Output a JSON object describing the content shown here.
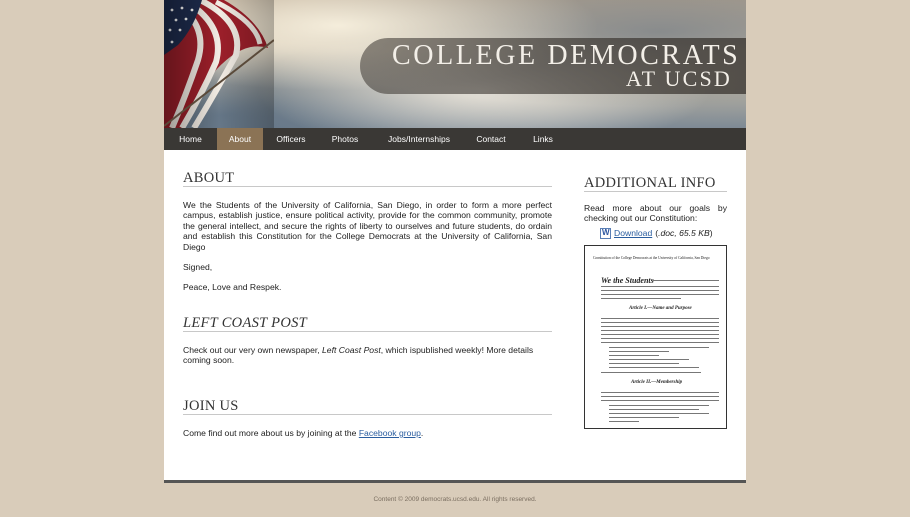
{
  "header": {
    "title_line1": "COLLEGE DEMOCRATS",
    "title_line2": "AT UCSD"
  },
  "nav": {
    "items": [
      {
        "label": "Home"
      },
      {
        "label": "About"
      },
      {
        "label": "Officers"
      },
      {
        "label": "Photos"
      },
      {
        "label": "Jobs/Internships"
      },
      {
        "label": "Contact"
      },
      {
        "label": "Links"
      }
    ],
    "active": "About"
  },
  "main": {
    "about_heading": "ABOUT",
    "about_text": "We the Students of the University of California, San Diego, in order to form a more perfect campus, establish justice, ensure political activity, provide for the common community, promote the general intellect, and secure the rights of liberty to ourselves and future students, do ordain and establish this Constitution for the College Democrats at the University of California, San Diego",
    "signed": "Signed,",
    "peace": "Peace, Love and Respek.",
    "lcp_heading": "LEFT COAST POST",
    "lcp_text_before": "Check out our very own newspaper, ",
    "lcp_text_italic": "Left Coast Post",
    "lcp_text_after": ", which ispublished weekly! More details coming soon.",
    "join_heading": "JOIN US",
    "join_text_before": "Come find out more about us by joining at the ",
    "join_link": "Facebook group",
    "join_text_after": "."
  },
  "sidebar": {
    "heading": "ADDITIONAL INFO",
    "read_text": "Read more about our goals by checking out our Constitution:",
    "download_label": "Download",
    "file_info_open": " (",
    "file_info": ".doc, 65.5 KB",
    "file_info_close": ")",
    "icon": "word-doc-icon",
    "preview": {
      "title": "Constitution of the College Democrats at the University of California, San Diego",
      "we_the": "We the Students",
      "article1": "Article I.—Name and Purpose",
      "article2": "Article II.—Membership"
    }
  },
  "footer": {
    "text": "Content © 2009 democrats.ucsd.edu.  All rights reserved."
  },
  "colors": {
    "background": "#d9ccba",
    "nav_bg": "#3a3835",
    "nav_active": "#8b7355",
    "link": "#2a5d9f"
  }
}
